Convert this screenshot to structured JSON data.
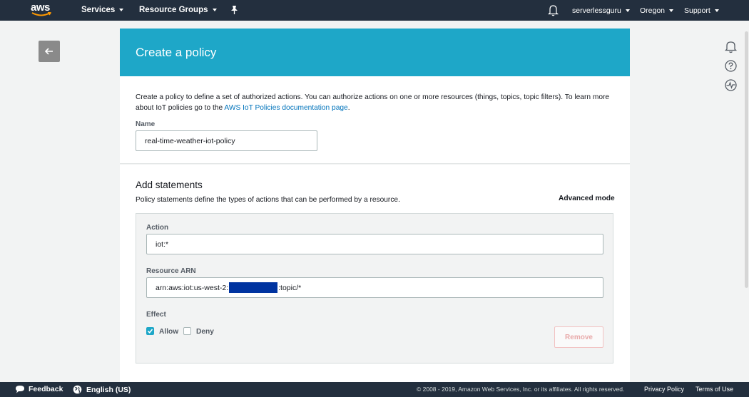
{
  "topnav": {
    "logo": "aws",
    "services": "Services",
    "resource_groups": "Resource Groups",
    "user": "serverlessguru",
    "region": "Oregon",
    "support": "Support"
  },
  "header": {
    "title": "Create a policy"
  },
  "intro": {
    "text_before": "Create a policy to define a set of authorized actions. You can authorize actions on one or more resources (things, topics, topic filters). To learn more about IoT policies go to the ",
    "link": "AWS IoT Policies documentation page",
    "text_after": "."
  },
  "name_field": {
    "label": "Name",
    "value": "real-time-weather-iot-policy"
  },
  "statements": {
    "title": "Add statements",
    "description": "Policy statements define the types of actions that can be performed by a resource.",
    "advanced_mode": "Advanced mode",
    "action_label": "Action",
    "action_value": "iot:*",
    "arn_label": "Resource ARN",
    "arn_prefix": "arn:aws:iot:us-west-2:",
    "arn_suffix": ":topic/*",
    "effect_label": "Effect",
    "allow_label": "Allow",
    "allow_checked": true,
    "deny_label": "Deny",
    "deny_checked": false,
    "remove_label": "Remove"
  },
  "footer": {
    "feedback": "Feedback",
    "language": "English (US)",
    "copyright": "© 2008 - 2019, Amazon Web Services, Inc. or its affiliates. All rights reserved.",
    "privacy": "Privacy Policy",
    "terms": "Terms of Use"
  },
  "colors": {
    "header_band": "#1ea7c8",
    "nav_bg": "#232f3e",
    "link": "#0073bb",
    "redaction": "#0033a0"
  },
  "icons": [
    "arrow-left-icon",
    "bell-icon",
    "help-icon",
    "activity-icon",
    "pin-icon",
    "speech-bubble-icon",
    "globe-icon"
  ]
}
